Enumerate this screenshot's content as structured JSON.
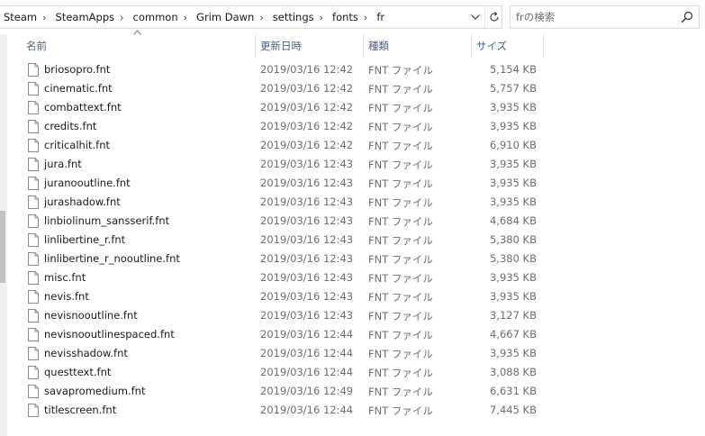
{
  "breadcrumb": [
    "Steam",
    "SteamApps",
    "common",
    "Grim Dawn",
    "settings",
    "fonts",
    "fr"
  ],
  "search": {
    "placeholder": "frの検索"
  },
  "columns": {
    "name": "名前",
    "date": "更新日時",
    "type": "種類",
    "size": "サイズ"
  },
  "files": [
    {
      "name": "briosopro.fnt",
      "date": "2019/03/16 12:42",
      "type": "FNT ファイル",
      "size": "5,154 KB"
    },
    {
      "name": "cinematic.fnt",
      "date": "2019/03/16 12:42",
      "type": "FNT ファイル",
      "size": "5,757 KB"
    },
    {
      "name": "combattext.fnt",
      "date": "2019/03/16 12:42",
      "type": "FNT ファイル",
      "size": "3,935 KB"
    },
    {
      "name": "credits.fnt",
      "date": "2019/03/16 12:42",
      "type": "FNT ファイル",
      "size": "3,935 KB"
    },
    {
      "name": "criticalhit.fnt",
      "date": "2019/03/16 12:42",
      "type": "FNT ファイル",
      "size": "6,910 KB"
    },
    {
      "name": "jura.fnt",
      "date": "2019/03/16 12:43",
      "type": "FNT ファイル",
      "size": "3,935 KB"
    },
    {
      "name": "juranooutline.fnt",
      "date": "2019/03/16 12:43",
      "type": "FNT ファイル",
      "size": "3,935 KB"
    },
    {
      "name": "jurashadow.fnt",
      "date": "2019/03/16 12:43",
      "type": "FNT ファイル",
      "size": "3,935 KB"
    },
    {
      "name": "linbiolinum_sansserif.fnt",
      "date": "2019/03/16 12:43",
      "type": "FNT ファイル",
      "size": "4,684 KB"
    },
    {
      "name": "linlibertine_r.fnt",
      "date": "2019/03/16 12:43",
      "type": "FNT ファイル",
      "size": "5,380 KB"
    },
    {
      "name": "linlibertine_r_nooutline.fnt",
      "date": "2019/03/16 12:43",
      "type": "FNT ファイル",
      "size": "5,380 KB"
    },
    {
      "name": "misc.fnt",
      "date": "2019/03/16 12:43",
      "type": "FNT ファイル",
      "size": "3,935 KB"
    },
    {
      "name": "nevis.fnt",
      "date": "2019/03/16 12:43",
      "type": "FNT ファイル",
      "size": "3,935 KB"
    },
    {
      "name": "nevisnooutline.fnt",
      "date": "2019/03/16 12:43",
      "type": "FNT ファイル",
      "size": "3,127 KB"
    },
    {
      "name": "nevisnooutlinespaced.fnt",
      "date": "2019/03/16 12:44",
      "type": "FNT ファイル",
      "size": "4,667 KB"
    },
    {
      "name": "nevisshadow.fnt",
      "date": "2019/03/16 12:44",
      "type": "FNT ファイル",
      "size": "3,935 KB"
    },
    {
      "name": "questtext.fnt",
      "date": "2019/03/16 12:44",
      "type": "FNT ファイル",
      "size": "3,088 KB"
    },
    {
      "name": "savapromedium.fnt",
      "date": "2019/03/16 12:49",
      "type": "FNT ファイル",
      "size": "6,631 KB"
    },
    {
      "name": "titlescreen.fnt",
      "date": "2019/03/16 12:44",
      "type": "FNT ファイル",
      "size": "7,445 KB"
    }
  ]
}
